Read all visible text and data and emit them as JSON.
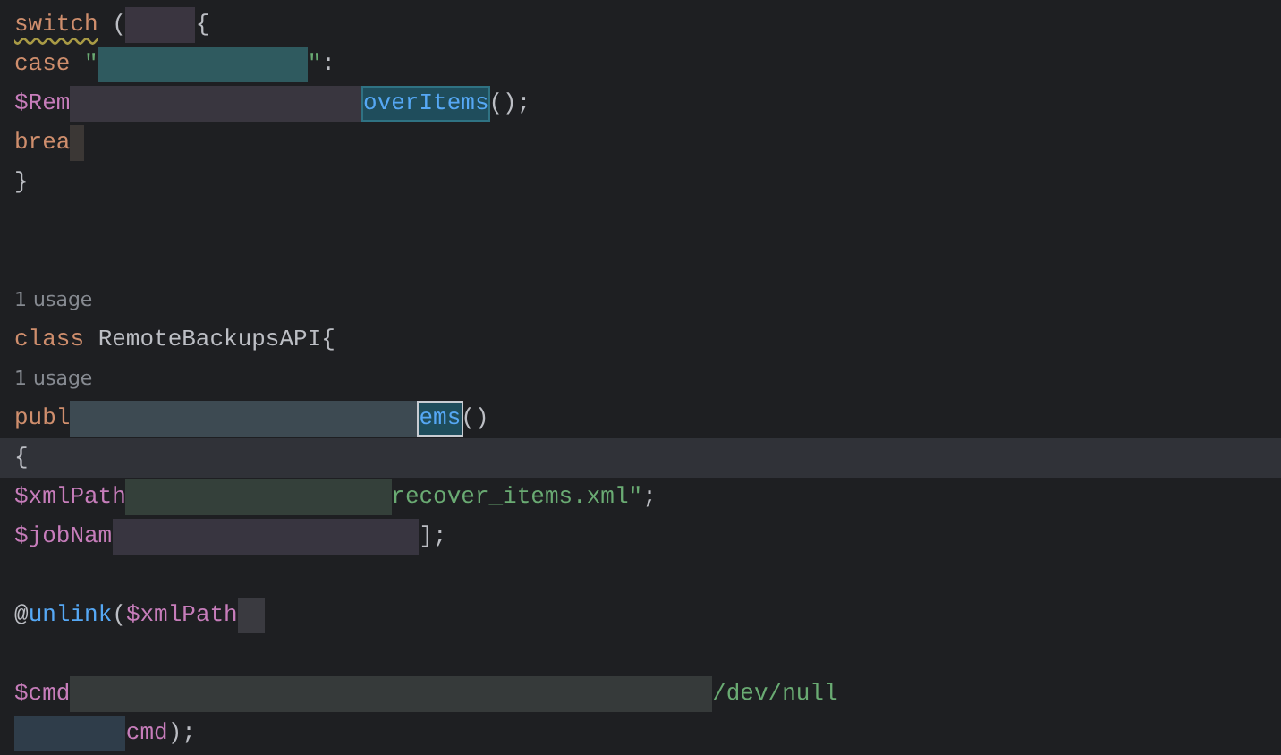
{
  "editor": {
    "lines": [
      {
        "kind": "code",
        "segments": [
          {
            "kind": "keyword",
            "text": "switch",
            "squiggle": true
          },
          {
            "kind": "plain",
            "text": " ("
          },
          {
            "kind": "redacted",
            "color": "#3a3540"
          },
          {
            "kind": "plain",
            "text": "{"
          }
        ]
      },
      {
        "kind": "code",
        "segments": [
          {
            "kind": "keyword",
            "text": "case "
          },
          {
            "kind": "string",
            "text": "\""
          },
          {
            "kind": "redacted",
            "color": "#2f5a5f"
          },
          {
            "kind": "string",
            "text": "\""
          },
          {
            "kind": "plain",
            "text": ":"
          }
        ]
      },
      {
        "kind": "code",
        "segments": [
          {
            "kind": "variable",
            "text": "$Rem"
          },
          {
            "kind": "redacted",
            "color": "#39363f"
          },
          {
            "kind": "function",
            "text": "overItems",
            "highlighted": true,
            "selected": false
          },
          {
            "kind": "plain",
            "text": "();"
          }
        ]
      },
      {
        "kind": "code",
        "segments": [
          {
            "kind": "keyword",
            "text": "brea"
          },
          {
            "kind": "redacted",
            "color": "#3b3735"
          }
        ]
      },
      {
        "kind": "code",
        "segments": [
          {
            "kind": "plain",
            "text": "}"
          }
        ]
      },
      {
        "kind": "blank"
      },
      {
        "kind": "blank"
      },
      {
        "kind": "code",
        "segments": [
          {
            "kind": "hint",
            "text": "1 usage"
          }
        ]
      },
      {
        "kind": "code",
        "segments": [
          {
            "kind": "keyword",
            "text": "class "
          },
          {
            "kind": "plain",
            "text": "RemoteBackupsAPI{"
          }
        ]
      },
      {
        "kind": "code",
        "segments": [
          {
            "kind": "hint",
            "text": "1 usage"
          }
        ]
      },
      {
        "kind": "code",
        "segments": [
          {
            "kind": "keyword",
            "text": "publ"
          },
          {
            "kind": "redacted",
            "color": "#3d4a52"
          },
          {
            "kind": "function",
            "text": "ems",
            "highlighted": true,
            "selected": true
          },
          {
            "kind": "plain",
            "text": "()"
          }
        ]
      },
      {
        "kind": "code",
        "current": true,
        "segments": [
          {
            "kind": "plain",
            "text": "{"
          }
        ]
      },
      {
        "kind": "code",
        "segments": [
          {
            "kind": "variable",
            "text": "$xmlPath"
          },
          {
            "kind": "redacted",
            "color": "#34403a"
          },
          {
            "kind": "string",
            "text": "recover_items.xml\""
          },
          {
            "kind": "plain",
            "text": ";"
          }
        ]
      },
      {
        "kind": "code",
        "segments": [
          {
            "kind": "variable",
            "text": "$jobNam"
          },
          {
            "kind": "redacted",
            "color": "#383540"
          },
          {
            "kind": "plain",
            "text": "];"
          }
        ]
      },
      {
        "kind": "blank"
      },
      {
        "kind": "code",
        "segments": [
          {
            "kind": "plain",
            "text": "@"
          },
          {
            "kind": "function",
            "text": "unlink"
          },
          {
            "kind": "plain",
            "text": "("
          },
          {
            "kind": "variable",
            "text": "$xmlPath"
          },
          {
            "kind": "redacted",
            "color": "#3a3a40"
          }
        ]
      },
      {
        "kind": "blank"
      },
      {
        "kind": "code",
        "segments": [
          {
            "kind": "variable",
            "text": "$cmd"
          },
          {
            "kind": "redacted",
            "color": "#363a3a"
          },
          {
            "kind": "string",
            "text": "/dev/null"
          }
        ]
      },
      {
        "kind": "code",
        "segments": [
          {
            "kind": "redacted",
            "color": "#2f3d4a"
          },
          {
            "kind": "variable",
            "text": "cmd"
          },
          {
            "kind": "plain",
            "text": ");"
          }
        ]
      }
    ]
  }
}
